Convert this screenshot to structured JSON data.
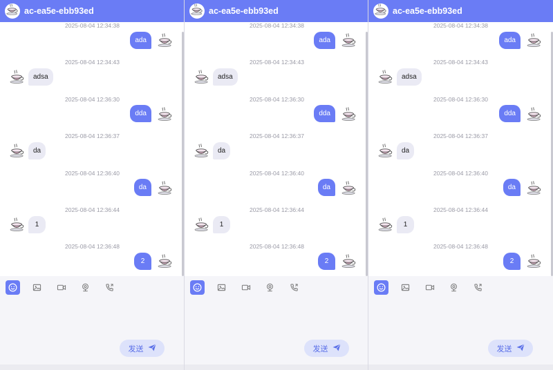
{
  "colors": {
    "accent": "#6a7cf5",
    "bubble_in": "#eaeaf4",
    "send_bg": "#dde2fb",
    "composer_bg": "#f5f5f9"
  },
  "panels": [
    {
      "title": "ac-ea5e-ebb93ed",
      "messages": [
        {
          "time": "2025-08-04 12:34:38",
          "direction": "out",
          "text": "ada"
        },
        {
          "time": "2025-08-04 12:34:43",
          "direction": "in",
          "text": "adsa"
        },
        {
          "time": "2025-08-04 12:36:30",
          "direction": "out",
          "text": "dda"
        },
        {
          "time": "2025-08-04 12:36:37",
          "direction": "in",
          "text": "da"
        },
        {
          "time": "2025-08-04 12:36:40",
          "direction": "out",
          "text": "da"
        },
        {
          "time": "2025-08-04 12:36:44",
          "direction": "in",
          "text": "1"
        },
        {
          "time": "2025-08-04 12:36:48",
          "direction": "out",
          "text": "2"
        }
      ],
      "send_label": "发送"
    },
    {
      "title": "ac-ea5e-ebb93ed",
      "messages": [
        {
          "time": "2025-08-04 12:34:38",
          "direction": "out",
          "text": "ada"
        },
        {
          "time": "2025-08-04 12:34:43",
          "direction": "in",
          "text": "adsa"
        },
        {
          "time": "2025-08-04 12:36:30",
          "direction": "out",
          "text": "dda"
        },
        {
          "time": "2025-08-04 12:36:37",
          "direction": "in",
          "text": "da"
        },
        {
          "time": "2025-08-04 12:36:40",
          "direction": "out",
          "text": "da"
        },
        {
          "time": "2025-08-04 12:36:44",
          "direction": "in",
          "text": "1"
        },
        {
          "time": "2025-08-04 12:36:48",
          "direction": "out",
          "text": "2"
        }
      ],
      "send_label": "发送"
    },
    {
      "title": "ac-ea5e-ebb93ed",
      "messages": [
        {
          "time": "2025-08-04 12:34:38",
          "direction": "out",
          "text": "ada"
        },
        {
          "time": "2025-08-04 12:34:43",
          "direction": "in",
          "text": "adsa"
        },
        {
          "time": "2025-08-04 12:36:30",
          "direction": "out",
          "text": "dda"
        },
        {
          "time": "2025-08-04 12:36:37",
          "direction": "in",
          "text": "da"
        },
        {
          "time": "2025-08-04 12:36:40",
          "direction": "out",
          "text": "da"
        },
        {
          "time": "2025-08-04 12:36:44",
          "direction": "in",
          "text": "1"
        },
        {
          "time": "2025-08-04 12:36:48",
          "direction": "out",
          "text": "2"
        }
      ],
      "send_label": "发送"
    }
  ],
  "toolbar_icons": [
    "emoji-icon",
    "image-icon",
    "video-icon",
    "camera-icon",
    "phone-icon"
  ]
}
